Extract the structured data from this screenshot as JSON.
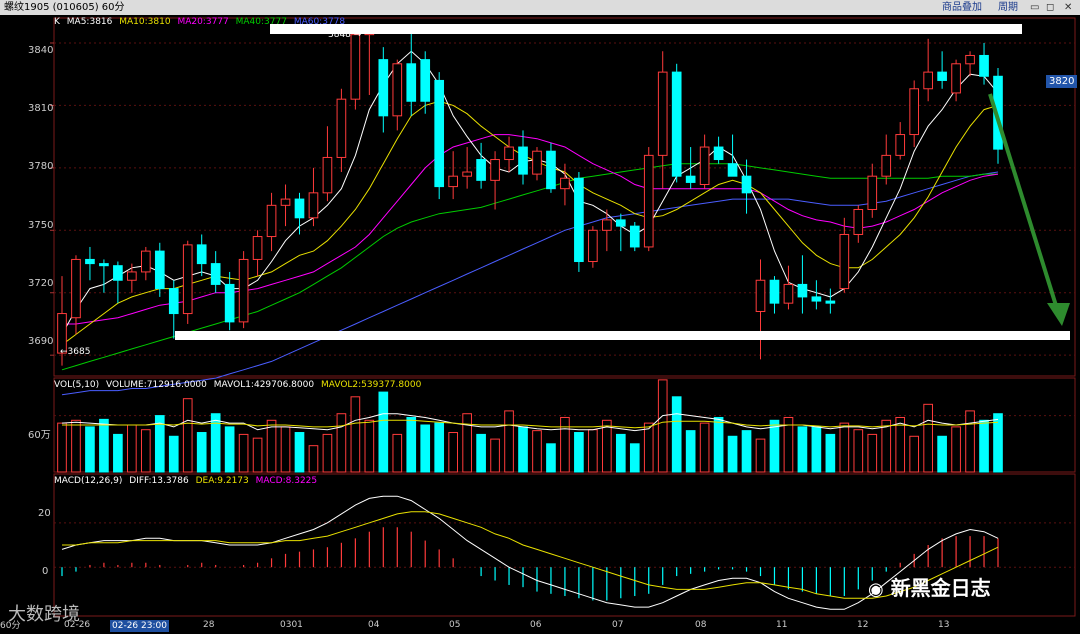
{
  "window": {
    "title": "螺纹1905 (010605) 60分",
    "menu_overlay": "商品叠加",
    "menu_cycle": "周期"
  },
  "price_panel": {
    "legend_k": "K",
    "ma5": "MA5:3816",
    "ma10": "MA10:3810",
    "ma20": "MA20:3777",
    "ma40": "MA40:3777",
    "ma60": "MA60:3778",
    "high_annot": "3848 →",
    "low_annot": "←3685",
    "current_price": "3820",
    "y_ticks": [
      "3840",
      "3810",
      "3780",
      "3750",
      "3720",
      "3690"
    ]
  },
  "volume_panel": {
    "legend_vol": "VOL(5,10)",
    "legend_volume": "VOLUME:712916.0000",
    "legend_mavol1": "MAVOL1:429706.8000",
    "legend_mavol2": "MAVOL2:539377.8000",
    "y_tick": "60万"
  },
  "macd_panel": {
    "legend_macd": "MACD(12,26,9)",
    "legend_diff": "DIFF:13.3786",
    "legend_dea": "DEA:9.2173",
    "legend_macd_val": "MACD:8.3225",
    "y_ticks": [
      "20",
      "0"
    ]
  },
  "x_axis": {
    "period_label": "60分",
    "highlight_time": "02-26 23:00",
    "labels": [
      "02-26",
      "28",
      "0301",
      "04",
      "05",
      "06",
      "07",
      "08",
      "11",
      "12",
      "13"
    ]
  },
  "watermarks": {
    "left": "大数跨境",
    "right": "新黑金日志"
  },
  "colors": {
    "up": "#ff3b3b",
    "down": "#00ffff",
    "ma5": "#ffffff",
    "ma10": "#e8e000",
    "ma20": "#ff00ff",
    "ma40": "#00cc00",
    "ma60": "#4a5dff",
    "arrow": "#2e8b2e",
    "macd_pos": "#ff3b3b",
    "macd_neg": "#00ffff"
  },
  "chart_data": {
    "type": "candlestick",
    "y_range": [
      3680,
      3852
    ],
    "volume_range_wan": [
      0,
      100
    ],
    "macd_range": [
      -22,
      42
    ],
    "candles": [
      {
        "o": 3691,
        "h": 3728,
        "l": 3685,
        "c": 3710
      },
      {
        "o": 3708,
        "h": 3738,
        "l": 3700,
        "c": 3736
      },
      {
        "o": 3736,
        "h": 3742,
        "l": 3726,
        "c": 3734
      },
      {
        "o": 3734,
        "h": 3736,
        "l": 3720,
        "c": 3733
      },
      {
        "o": 3733,
        "h": 3735,
        "l": 3715,
        "c": 3726
      },
      {
        "o": 3726,
        "h": 3734,
        "l": 3720,
        "c": 3730
      },
      {
        "o": 3730,
        "h": 3742,
        "l": 3726,
        "c": 3740
      },
      {
        "o": 3740,
        "h": 3744,
        "l": 3718,
        "c": 3722
      },
      {
        "o": 3722,
        "h": 3726,
        "l": 3698,
        "c": 3710
      },
      {
        "o": 3710,
        "h": 3745,
        "l": 3705,
        "c": 3743
      },
      {
        "o": 3743,
        "h": 3748,
        "l": 3728,
        "c": 3734
      },
      {
        "o": 3734,
        "h": 3740,
        "l": 3720,
        "c": 3724
      },
      {
        "o": 3724,
        "h": 3730,
        "l": 3702,
        "c": 3706
      },
      {
        "o": 3706,
        "h": 3740,
        "l": 3703,
        "c": 3736
      },
      {
        "o": 3736,
        "h": 3750,
        "l": 3728,
        "c": 3747
      },
      {
        "o": 3747,
        "h": 3768,
        "l": 3740,
        "c": 3762
      },
      {
        "o": 3762,
        "h": 3772,
        "l": 3752,
        "c": 3765
      },
      {
        "o": 3765,
        "h": 3768,
        "l": 3748,
        "c": 3756
      },
      {
        "o": 3756,
        "h": 3780,
        "l": 3752,
        "c": 3768
      },
      {
        "o": 3768,
        "h": 3800,
        "l": 3764,
        "c": 3785
      },
      {
        "o": 3785,
        "h": 3818,
        "l": 3778,
        "c": 3813
      },
      {
        "o": 3813,
        "h": 3848,
        "l": 3808,
        "c": 3844
      },
      {
        "o": 3844,
        "h": 3848,
        "l": 3815,
        "c": 3848
      },
      {
        "o": 3832,
        "h": 3838,
        "l": 3797,
        "c": 3805
      },
      {
        "o": 3805,
        "h": 3832,
        "l": 3798,
        "c": 3830
      },
      {
        "o": 3830,
        "h": 3845,
        "l": 3805,
        "c": 3812
      },
      {
        "o": 3832,
        "h": 3836,
        "l": 3806,
        "c": 3812
      },
      {
        "o": 3822,
        "h": 3826,
        "l": 3765,
        "c": 3771
      },
      {
        "o": 3771,
        "h": 3788,
        "l": 3765,
        "c": 3776
      },
      {
        "o": 3776,
        "h": 3790,
        "l": 3770,
        "c": 3778
      },
      {
        "o": 3784,
        "h": 3792,
        "l": 3770,
        "c": 3774
      },
      {
        "o": 3774,
        "h": 3788,
        "l": 3760,
        "c": 3784
      },
      {
        "o": 3784,
        "h": 3795,
        "l": 3778,
        "c": 3790
      },
      {
        "o": 3790,
        "h": 3798,
        "l": 3772,
        "c": 3777
      },
      {
        "o": 3777,
        "h": 3790,
        "l": 3774,
        "c": 3788
      },
      {
        "o": 3788,
        "h": 3792,
        "l": 3768,
        "c": 3770
      },
      {
        "o": 3770,
        "h": 3782,
        "l": 3762,
        "c": 3775
      },
      {
        "o": 3775,
        "h": 3778,
        "l": 3730,
        "c": 3735
      },
      {
        "o": 3735,
        "h": 3752,
        "l": 3732,
        "c": 3750
      },
      {
        "o": 3750,
        "h": 3760,
        "l": 3740,
        "c": 3755
      },
      {
        "o": 3755,
        "h": 3758,
        "l": 3740,
        "c": 3752
      },
      {
        "o": 3752,
        "h": 3754,
        "l": 3740,
        "c": 3742
      },
      {
        "o": 3742,
        "h": 3790,
        "l": 3740,
        "c": 3786
      },
      {
        "o": 3786,
        "h": 3836,
        "l": 3770,
        "c": 3826
      },
      {
        "o": 3826,
        "h": 3830,
        "l": 3773,
        "c": 3776
      },
      {
        "o": 3776,
        "h": 3790,
        "l": 3770,
        "c": 3773
      },
      {
        "o": 3772,
        "h": 3796,
        "l": 3770,
        "c": 3790
      },
      {
        "o": 3790,
        "h": 3795,
        "l": 3782,
        "c": 3784
      },
      {
        "o": 3782,
        "h": 3796,
        "l": 3776,
        "c": 3776
      },
      {
        "o": 3776,
        "h": 3784,
        "l": 3758,
        "c": 3768
      },
      {
        "o": 3711,
        "h": 3736,
        "l": 3688,
        "c": 3726
      },
      {
        "o": 3726,
        "h": 3728,
        "l": 3710,
        "c": 3715
      },
      {
        "o": 3715,
        "h": 3733,
        "l": 3712,
        "c": 3724
      },
      {
        "o": 3724,
        "h": 3738,
        "l": 3710,
        "c": 3718
      },
      {
        "o": 3718,
        "h": 3726,
        "l": 3712,
        "c": 3716
      },
      {
        "o": 3716,
        "h": 3722,
        "l": 3710,
        "c": 3715
      },
      {
        "o": 3722,
        "h": 3756,
        "l": 3720,
        "c": 3748
      },
      {
        "o": 3748,
        "h": 3762,
        "l": 3744,
        "c": 3760
      },
      {
        "o": 3760,
        "h": 3782,
        "l": 3756,
        "c": 3776
      },
      {
        "o": 3776,
        "h": 3796,
        "l": 3772,
        "c": 3786
      },
      {
        "o": 3786,
        "h": 3802,
        "l": 3784,
        "c": 3796
      },
      {
        "o": 3796,
        "h": 3822,
        "l": 3790,
        "c": 3818
      },
      {
        "o": 3818,
        "h": 3842,
        "l": 3812,
        "c": 3826
      },
      {
        "o": 3826,
        "h": 3836,
        "l": 3818,
        "c": 3822
      },
      {
        "o": 3816,
        "h": 3832,
        "l": 3812,
        "c": 3830
      },
      {
        "o": 3830,
        "h": 3836,
        "l": 3824,
        "c": 3834
      },
      {
        "o": 3834,
        "h": 3840,
        "l": 3820,
        "c": 3824
      },
      {
        "o": 3824,
        "h": 3828,
        "l": 3782,
        "c": 3789
      }
    ],
    "volume_wan": [
      52,
      55,
      48,
      56,
      40,
      50,
      45,
      60,
      38,
      78,
      42,
      62,
      48,
      40,
      36,
      55,
      48,
      42,
      28,
      40,
      62,
      80,
      55,
      85,
      40,
      58,
      50,
      52,
      42,
      62,
      40,
      35,
      65,
      48,
      44,
      30,
      58,
      42,
      45,
      55,
      40,
      30,
      52,
      98,
      80,
      44,
      52,
      58,
      38,
      44,
      35,
      55,
      58,
      48,
      48,
      40,
      52,
      45,
      40,
      55,
      58,
      38,
      72,
      38,
      48,
      65,
      55,
      62
    ],
    "ma5": [
      3700,
      3712,
      3722,
      3724,
      3728,
      3732,
      3733,
      3730,
      3726,
      3728,
      3730,
      3728,
      3722,
      3722,
      3726,
      3735,
      3745,
      3752,
      3756,
      3762,
      3770,
      3786,
      3808,
      3820,
      3830,
      3836,
      3830,
      3820,
      3805,
      3795,
      3786,
      3780,
      3778,
      3783,
      3784,
      3782,
      3777,
      3764,
      3762,
      3758,
      3752,
      3748,
      3752,
      3764,
      3776,
      3780,
      3784,
      3790,
      3786,
      3774,
      3760,
      3740,
      3725,
      3722,
      3720,
      3718,
      3722,
      3730,
      3742,
      3756,
      3770,
      3788,
      3800,
      3808,
      3818,
      3825,
      3824,
      3816
    ],
    "ma10": [
      3695,
      3700,
      3705,
      3710,
      3715,
      3718,
      3720,
      3722,
      3722,
      3724,
      3726,
      3728,
      3727,
      3726,
      3728,
      3730,
      3734,
      3738,
      3740,
      3745,
      3752,
      3760,
      3770,
      3782,
      3794,
      3805,
      3810,
      3812,
      3810,
      3806,
      3800,
      3795,
      3790,
      3786,
      3783,
      3780,
      3778,
      3772,
      3768,
      3765,
      3762,
      3758,
      3756,
      3757,
      3760,
      3764,
      3768,
      3772,
      3774,
      3772,
      3768,
      3760,
      3752,
      3744,
      3738,
      3734,
      3732,
      3732,
      3736,
      3742,
      3748,
      3756,
      3766,
      3778,
      3790,
      3800,
      3808,
      3810
    ],
    "ma20": [
      3705,
      3705,
      3706,
      3707,
      3708,
      3710,
      3712,
      3714,
      3715,
      3716,
      3718,
      3720,
      3720,
      3721,
      3722,
      3724,
      3726,
      3728,
      3730,
      3734,
      3738,
      3742,
      3748,
      3756,
      3764,
      3772,
      3780,
      3786,
      3790,
      3792,
      3794,
      3796,
      3796,
      3795,
      3794,
      3792,
      3790,
      3786,
      3782,
      3779,
      3776,
      3772,
      3770,
      3770,
      3770,
      3770,
      3770,
      3770,
      3770,
      3770,
      3768,
      3764,
      3760,
      3757,
      3755,
      3754,
      3752,
      3751,
      3752,
      3754,
      3757,
      3760,
      3764,
      3768,
      3771,
      3774,
      3776,
      3777
    ],
    "ma40": [
      3683,
      3685,
      3687,
      3689,
      3691,
      3693,
      3695,
      3697,
      3699,
      3701,
      3703,
      3705,
      3707,
      3709,
      3711,
      3714,
      3717,
      3720,
      3724,
      3728,
      3732,
      3737,
      3742,
      3747,
      3751,
      3754,
      3756,
      3758,
      3759,
      3760,
      3761,
      3763,
      3765,
      3767,
      3769,
      3771,
      3773,
      3775,
      3776,
      3777,
      3778,
      3779,
      3780,
      3781,
      3782,
      3782,
      3782,
      3782,
      3782,
      3781,
      3780,
      3779,
      3778,
      3777,
      3776,
      3775,
      3775,
      3775,
      3775,
      3775,
      3775,
      3775,
      3775,
      3776,
      3776,
      3776,
      3777,
      3777
    ],
    "ma60": [
      3671,
      3672,
      3673,
      3673,
      3673,
      3674,
      3674,
      3675,
      3676,
      3677,
      3678,
      3679,
      3681,
      3683,
      3685,
      3687,
      3690,
      3693,
      3696,
      3699,
      3702,
      3705,
      3708,
      3711,
      3714,
      3717,
      3720,
      3723,
      3726,
      3729,
      3732,
      3735,
      3738,
      3741,
      3744,
      3747,
      3750,
      3752,
      3754,
      3756,
      3757,
      3758,
      3759,
      3760,
      3761,
      3762,
      3763,
      3764,
      3765,
      3765,
      3765,
      3765,
      3765,
      3764,
      3763,
      3762,
      3762,
      3762,
      3763,
      3764,
      3766,
      3768,
      3770,
      3772,
      3774,
      3776,
      3777,
      3778
    ],
    "mavol1": [
      52,
      53,
      52,
      51,
      50,
      50,
      50,
      52,
      48,
      55,
      52,
      55,
      52,
      52,
      45,
      48,
      48,
      47,
      46,
      45,
      48,
      55,
      58,
      62,
      62,
      60,
      58,
      55,
      52,
      50,
      48,
      48,
      50,
      48,
      46,
      45,
      46,
      45,
      45,
      48,
      46,
      44,
      46,
      60,
      62,
      60,
      58,
      56,
      52,
      48,
      46,
      48,
      50,
      50,
      48,
      46,
      48,
      48,
      46,
      48,
      52,
      48,
      55,
      52,
      50,
      52,
      54,
      56
    ],
    "mavol2": [
      50,
      50,
      50,
      50,
      50,
      50,
      50,
      51,
      50,
      52,
      51,
      52,
      51,
      51,
      49,
      50,
      50,
      49,
      48,
      48,
      49,
      52,
      53,
      55,
      55,
      55,
      54,
      53,
      52,
      51,
      50,
      50,
      50,
      50,
      49,
      48,
      48,
      48,
      48,
      49,
      48,
      47,
      48,
      53,
      54,
      54,
      54,
      53,
      52,
      50,
      49,
      50,
      50,
      50,
      49,
      48,
      49,
      49,
      48,
      49,
      50,
      49,
      51,
      50,
      50,
      51,
      52,
      53
    ],
    "macd_hist": [
      -4,
      -2,
      1,
      2,
      1,
      2,
      2,
      1,
      0,
      1,
      2,
      1,
      0,
      1,
      2,
      4,
      6,
      7,
      8,
      9,
      11,
      13,
      16,
      18,
      18,
      16,
      12,
      8,
      4,
      0,
      -4,
      -6,
      -8,
      -9,
      -11,
      -12,
      -13,
      -14,
      -15,
      -15,
      -14,
      -13,
      -12,
      -8,
      -4,
      -3,
      -2,
      -1,
      -1,
      -2,
      -4,
      -8,
      -10,
      -11,
      -12,
      -13,
      -13,
      -10,
      -6,
      -2,
      2,
      6,
      10,
      13,
      14,
      14,
      14,
      13
    ],
    "macd_diff": [
      8,
      10,
      11,
      12,
      12,
      12,
      13,
      13,
      12,
      12,
      12,
      11,
      10,
      10,
      10,
      11,
      13,
      15,
      17,
      20,
      24,
      28,
      31,
      32,
      32,
      30,
      26,
      22,
      17,
      12,
      8,
      4,
      0,
      -3,
      -6,
      -8,
      -10,
      -12,
      -14,
      -16,
      -17,
      -18,
      -18,
      -16,
      -13,
      -10,
      -8,
      -6,
      -5,
      -5,
      -7,
      -11,
      -14,
      -16,
      -18,
      -19,
      -19,
      -16,
      -12,
      -7,
      -2,
      3,
      8,
      12,
      15,
      17,
      16,
      13
    ],
    "macd_dea": [
      10,
      10,
      11,
      11,
      11,
      12,
      12,
      12,
      12,
      12,
      12,
      12,
      11,
      11,
      11,
      11,
      12,
      12,
      13,
      14,
      16,
      18,
      20,
      22,
      24,
      25,
      25,
      24,
      22,
      20,
      18,
      15,
      13,
      10,
      8,
      6,
      4,
      2,
      0,
      -2,
      -4,
      -6,
      -8,
      -9,
      -10,
      -10,
      -10,
      -9,
      -8,
      -7,
      -7,
      -8,
      -9,
      -10,
      -12,
      -13,
      -14,
      -14,
      -14,
      -13,
      -11,
      -9,
      -6,
      -3,
      0,
      3,
      6,
      9
    ]
  }
}
